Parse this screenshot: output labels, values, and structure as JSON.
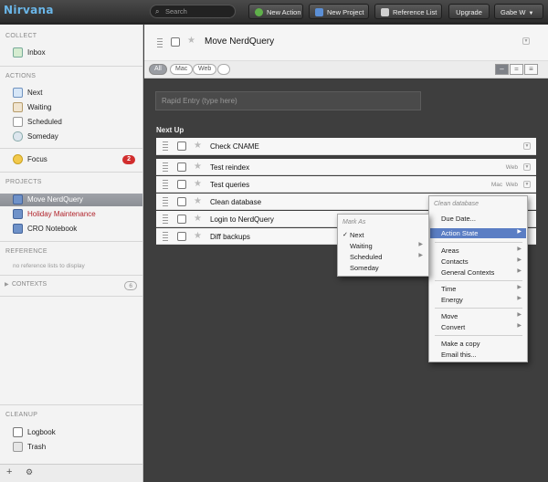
{
  "app": {
    "logo": "Nirvana"
  },
  "topbar": {
    "search_placeholder": "Search",
    "new_action": "New Action",
    "new_project": "New Project",
    "reference_list": "Reference List",
    "upgrade": "Upgrade",
    "user": "Gabe W"
  },
  "sidebar": {
    "collect": "COLLECT",
    "inbox": "Inbox",
    "actions": "ACTIONS",
    "next": "Next",
    "waiting": "Waiting",
    "scheduled": "Scheduled",
    "someday": "Someday",
    "focus": "Focus",
    "focus_count": "2",
    "projects": "PROJECTS",
    "project_items": [
      "Move NerdQuery",
      "Holiday Maintenance",
      "CRO Notebook"
    ],
    "reference": "REFERENCE",
    "no_reference": "no reference lists to display",
    "contexts": "CONTEXTS",
    "contexts_count": "6",
    "cleanup": "CLEANUP",
    "logbook": "Logbook",
    "trash": "Trash",
    "add_glyph": "+",
    "settings_glyph": "⚙"
  },
  "project": {
    "title": "Move NerdQuery"
  },
  "filters": {
    "all": "All",
    "mac": "Mac",
    "web": "Web"
  },
  "view_buttons": [
    "–",
    "=",
    "≡"
  ],
  "rapid_entry": {
    "placeholder": "Rapid Entry (type here)"
  },
  "section": {
    "next_up": "Next Up"
  },
  "tasks": [
    {
      "label": "Check CNAME",
      "tags": ""
    },
    {
      "label": "Test reindex",
      "tags": "Web"
    },
    {
      "label": "Test queries",
      "tags": "Mac  Web"
    },
    {
      "label": "Clean database",
      "tags": ""
    },
    {
      "label": "Login to NerdQuery",
      "tags": ""
    },
    {
      "label": "Diff backups",
      "tags": ""
    }
  ],
  "context_menu": {
    "header": "Clean database",
    "due_date": "Due Date...",
    "action_state": "Action State",
    "areas": "Areas",
    "contacts": "Contacts",
    "general_contexts": "General Contexts",
    "time": "Time",
    "energy": "Energy",
    "move": "Move",
    "convert": "Convert",
    "make_copy": "Make a copy",
    "email_this": "Email this..."
  },
  "submenu": {
    "header": "Mark As",
    "check": "✓",
    "next": "Next",
    "waiting": "Waiting",
    "scheduled": "Scheduled",
    "someday": "Someday"
  },
  "colors": {
    "accent": "#5b7ec4",
    "badge": "#d12d2d",
    "active_project": "#9a9da3",
    "holiday_text": "#b0222a"
  }
}
